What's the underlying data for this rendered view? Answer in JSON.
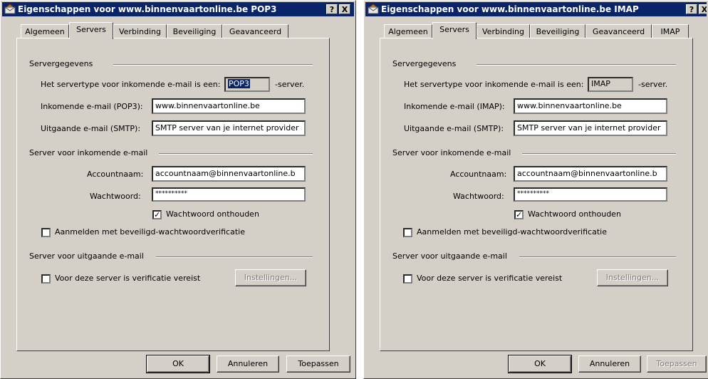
{
  "win1": {
    "title": "Eigenschappen voor www.binnenvaartonline.be POP3",
    "help_btn": "?",
    "close_btn": "X",
    "tabs": [
      "Algemeen",
      "Servers",
      "Verbinding",
      "Beveiliging",
      "Geavanceerd"
    ],
    "group_server": "Servergegevens",
    "type_label": "Het servertype voor inkomende e-mail is een:",
    "type_value": "POP3",
    "type_suffix": "-server.",
    "incoming_label": "Inkomende e-mail (POP3):",
    "incoming_value": "www.binnenvaartonline.be",
    "outgoing_label": "Uitgaande e-mail (SMTP):",
    "outgoing_value": "SMTP server van je internet provider",
    "group_incoming": "Server voor inkomende e-mail",
    "account_label": "Accountnaam:",
    "account_value": "accountnaam@binnenvaartonline.b",
    "password_label": "Wachtwoord:",
    "password_value": "**********",
    "remember_label": "Wachtwoord onthouden",
    "spa_label": "Aanmelden met beveiligd-wachtwoordverificatie",
    "group_outgoing": "Server voor uitgaande e-mail",
    "auth_label": "Voor deze server is verificatie vereist",
    "settings_btn": "Instellingen...",
    "ok_btn": "OK",
    "cancel_btn": "Annuleren",
    "apply_btn": "Toepassen"
  },
  "win2": {
    "title": "Eigenschappen voor www.binnenvaartonline.be IMAP",
    "help_btn": "?",
    "close_btn": "X",
    "tabs": [
      "Algemeen",
      "Servers",
      "Verbinding",
      "Beveiliging",
      "Geavanceerd",
      "IMAP"
    ],
    "group_server": "Servergegevens",
    "type_label": "Het servertype voor inkomende e-mail is een:",
    "type_value": "IMAP",
    "type_suffix": "-server.",
    "incoming_label": "Inkomende e-mail (IMAP):",
    "incoming_value": "www.binnenvaartonline.be",
    "outgoing_label": "Uitgaande e-mail (SMTP):",
    "outgoing_value": "SMTP server van je internet provider",
    "group_incoming": "Server voor inkomende e-mail",
    "account_label": "Accountnaam:",
    "account_value": "accountnaam@binnenvaartonline.b",
    "password_label": "Wachtwoord:",
    "password_value": "**********",
    "remember_label": "Wachtwoord onthouden",
    "spa_label": "Aanmelden met beveiligd-wachtwoordverificatie",
    "group_outgoing": "Server voor uitgaande e-mail",
    "auth_label": "Voor deze server is verificatie vereist",
    "settings_btn": "Instellingen...",
    "ok_btn": "OK",
    "cancel_btn": "Annuleren",
    "apply_btn": "Toepassen"
  },
  "colors": {
    "titlebar": "#0a246a",
    "face": "#d4d0c8",
    "selection": "#0a246a"
  }
}
